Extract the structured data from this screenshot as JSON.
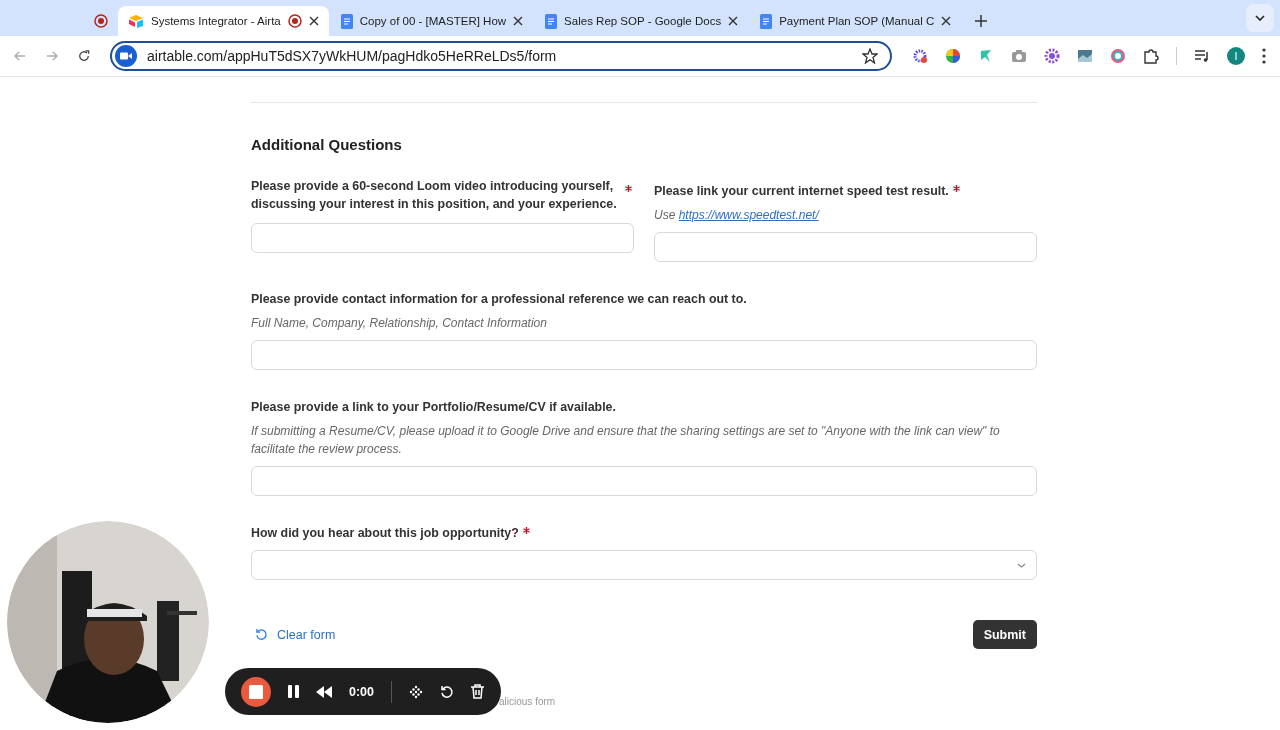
{
  "browser": {
    "tabs": [
      {
        "kind": "pinned",
        "selected": false,
        "recording": true
      },
      {
        "kind": "airtable",
        "title": "Systems Integrator - Airta",
        "selected": true,
        "recording": true
      },
      {
        "kind": "docs",
        "title": "Copy of 00 - [MASTER] How",
        "selected": false,
        "recording": false
      },
      {
        "kind": "docs",
        "title": "Sales Rep SOP - Google Docs",
        "selected": false,
        "recording": false
      },
      {
        "kind": "docs",
        "title": "Payment Plan SOP (Manual C",
        "selected": false,
        "recording": false
      }
    ],
    "address": "airtable.com/appHuT5dSX7yWkHUM/pagHdko5HeRReLDs5/form",
    "profile": "I"
  },
  "form": {
    "section_title": "Additional Questions",
    "rows": [
      [
        {
          "kind": "text",
          "label": "Please provide a 60-second Loom video introducing yourself, discussing your interest in this position, and your experience.",
          "required": true
        },
        {
          "kind": "text",
          "label": "Please link your current internet speed test result.",
          "required": true,
          "hint": "Use",
          "hint_link": "https://www.speedtest.net/"
        }
      ],
      [
        {
          "kind": "text",
          "label": "Please provide contact information for a professional reference we can reach out to.",
          "required": false,
          "hint": "Full Name, Company, Relationship, Contact Information"
        }
      ],
      [
        {
          "kind": "text",
          "label": "Please provide a link to your Portfolio/Resume/CV if available.",
          "required": false,
          "hint": "If submitting a Resume/CV, please upload it to Google Drive and ensure that the sharing settings are set to \"Anyone with the link can view\" to facilitate the review process."
        }
      ],
      [
        {
          "kind": "select",
          "label": "How did you hear about this job opportunity?",
          "required": true
        }
      ]
    ],
    "clear_button": "Clear form",
    "submit_button": "Submit",
    "footer_text": "alicious form"
  },
  "recorder": {
    "time": "0:00"
  }
}
